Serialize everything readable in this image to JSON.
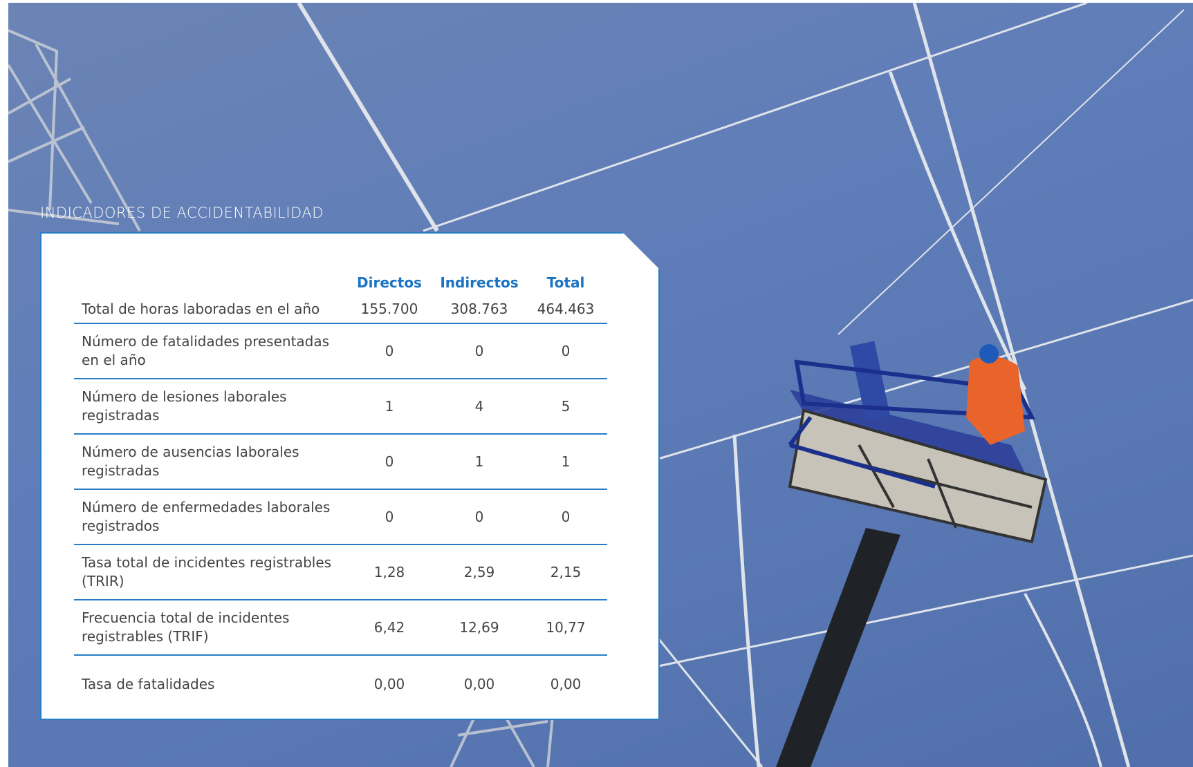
{
  "section_title": "INDICADORES  DE ACCIDENTABILIDAD",
  "table": {
    "headers": [
      "",
      "Directos",
      "Indirectos",
      "Total"
    ],
    "rows": [
      {
        "label": "Total de horas laboradas en el año",
        "directos": "155.700",
        "indirectos": "308.763",
        "total": "464.463"
      },
      {
        "label": "Número de fatalidades presentadas en el año",
        "directos": "0",
        "indirectos": "0",
        "total": "0"
      },
      {
        "label": "Número de lesiones laborales registradas",
        "directos": "1",
        "indirectos": "4",
        "total": "5"
      },
      {
        "label": "Número de ausencias laborales registradas",
        "directos": "0",
        "indirectos": "1",
        "total": "1"
      },
      {
        "label": "Número de enfermedades laborales registrados",
        "directos": "0",
        "indirectos": "0",
        "total": "0"
      },
      {
        "label": "Tasa total de incidentes registrables (TRIR)",
        "directos": "1,28",
        "indirectos": "2,59",
        "total": "2,15"
      },
      {
        "label": "Frecuencia total de incidentes registrables (TRIF)",
        "directos": "6,42",
        "indirectos": "12,69",
        "total": "10,77"
      },
      {
        "label": "Tasa de fatalidades",
        "directos": "0,00",
        "indirectos": "0,00",
        "total": "0,00"
      }
    ]
  },
  "colors": {
    "accent": "#1b73c3",
    "border": "#2a7cc5",
    "sky": "#5f7db8"
  }
}
